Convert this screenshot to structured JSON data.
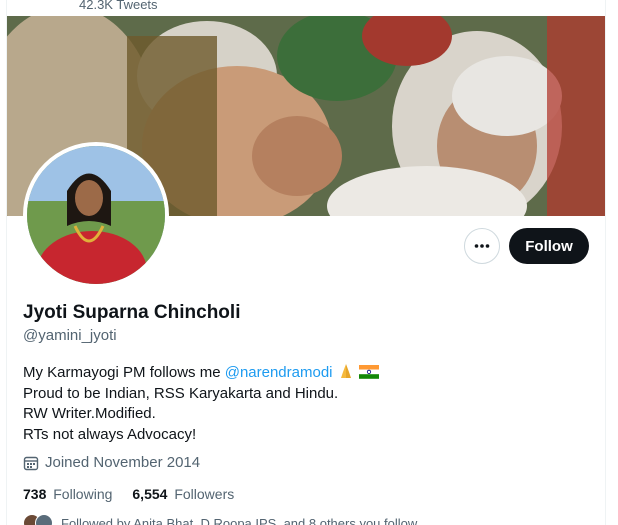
{
  "header": {
    "tweet_count": "42.3K Tweets"
  },
  "profile": {
    "name": "Jyoti Suparna Chincholi",
    "handle": "@yamini_jyoti",
    "bio": {
      "line1_prefix": "My Karmayogi PM follows me ",
      "line1_mention": "@narendramodi",
      "line2": "Proud to be Indian, RSS Karyakarta and Hindu.",
      "line3": "RW Writer.Modified.",
      "line4": "RTs not always Advocacy!"
    },
    "joined": "Joined November 2014",
    "following_count": "738",
    "following_label": "Following",
    "followers_count": "6,554",
    "followers_label": "Followers",
    "followed_by": "Followed by Anita Bhat, D Roopa IPS, and 8 others you follow"
  },
  "actions": {
    "follow_label": "Follow",
    "more_label": "More"
  },
  "colors": {
    "accent": "#1d9bf0",
    "text": "#0f1419",
    "muted": "#536471",
    "button_bg": "#0f1419"
  },
  "icons": [
    "more-icon",
    "calendar-icon",
    "folded-hands-emoji",
    "india-flag-emoji"
  ]
}
